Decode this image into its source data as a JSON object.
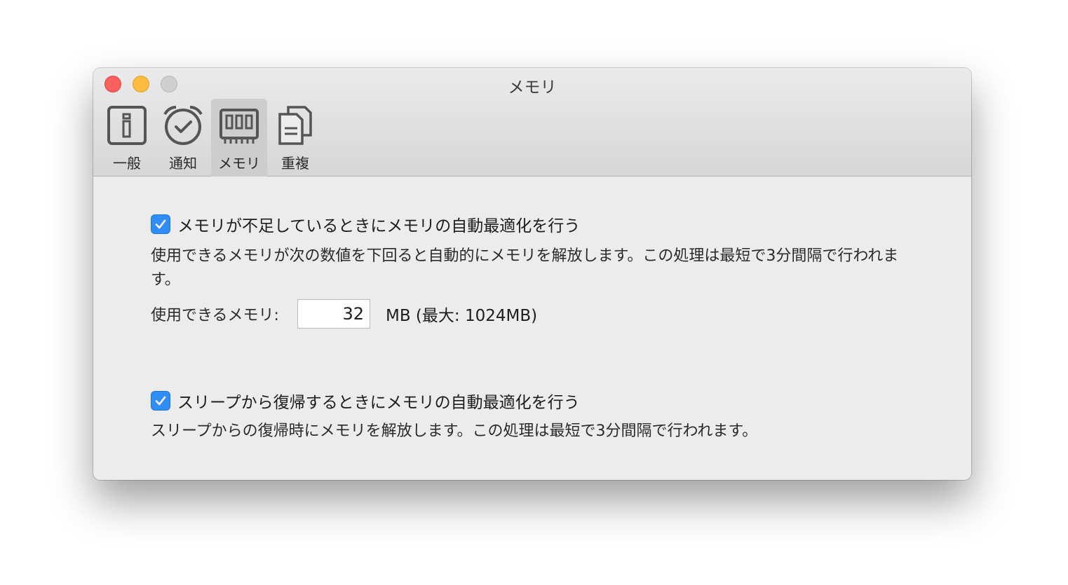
{
  "window": {
    "title": "メモリ"
  },
  "toolbar": {
    "items": [
      {
        "label": "一般",
        "icon": "info-icon",
        "selected": false
      },
      {
        "label": "通知",
        "icon": "alarm-clock-icon",
        "selected": false
      },
      {
        "label": "メモリ",
        "icon": "memory-chip-icon",
        "selected": true
      },
      {
        "label": "重複",
        "icon": "duplicate-documents-icon",
        "selected": false
      }
    ]
  },
  "low_memory": {
    "checkbox_label": "メモリが不足しているときにメモリの自動最適化を行う",
    "checked": true,
    "description": "使用できるメモリが次の数値を下回ると自動的にメモリを解放します。この処理は最短で3分間隔で行われます。",
    "threshold_label": "使用できるメモリ:",
    "threshold_value": "32",
    "threshold_unit": "MB (最大: 1024MB)"
  },
  "wake": {
    "checkbox_label": "スリープから復帰するときにメモリの自動最適化を行う",
    "checked": true,
    "description": "スリープからの復帰時にメモリを解放します。この処理は最短で3分間隔で行われます。"
  },
  "colors": {
    "accent": "#2f8ef6",
    "close": "#fc605c",
    "minimize": "#fdbc40",
    "zoom": "#cfcfcf"
  }
}
